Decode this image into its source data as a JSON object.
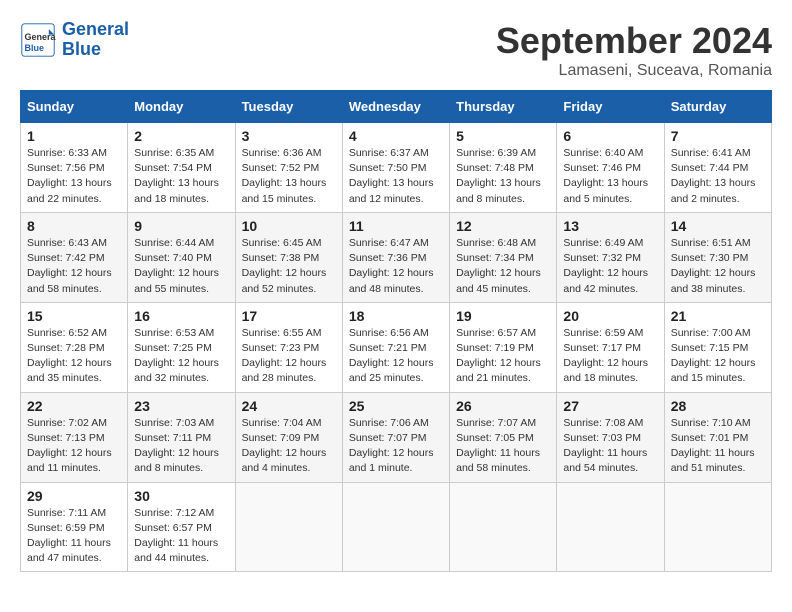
{
  "header": {
    "logo_text_general": "General",
    "logo_text_blue": "Blue",
    "month_year": "September 2024",
    "location": "Lamaseni, Suceava, Romania"
  },
  "weekdays": [
    "Sunday",
    "Monday",
    "Tuesday",
    "Wednesday",
    "Thursday",
    "Friday",
    "Saturday"
  ],
  "weeks": [
    [
      {
        "day": "1",
        "sunrise": "6:33 AM",
        "sunset": "7:56 PM",
        "daylight": "13 hours and 22 minutes."
      },
      {
        "day": "2",
        "sunrise": "6:35 AM",
        "sunset": "7:54 PM",
        "daylight": "13 hours and 18 minutes."
      },
      {
        "day": "3",
        "sunrise": "6:36 AM",
        "sunset": "7:52 PM",
        "daylight": "13 hours and 15 minutes."
      },
      {
        "day": "4",
        "sunrise": "6:37 AM",
        "sunset": "7:50 PM",
        "daylight": "13 hours and 12 minutes."
      },
      {
        "day": "5",
        "sunrise": "6:39 AM",
        "sunset": "7:48 PM",
        "daylight": "13 hours and 8 minutes."
      },
      {
        "day": "6",
        "sunrise": "6:40 AM",
        "sunset": "7:46 PM",
        "daylight": "13 hours and 5 minutes."
      },
      {
        "day": "7",
        "sunrise": "6:41 AM",
        "sunset": "7:44 PM",
        "daylight": "13 hours and 2 minutes."
      }
    ],
    [
      {
        "day": "8",
        "sunrise": "6:43 AM",
        "sunset": "7:42 PM",
        "daylight": "12 hours and 58 minutes."
      },
      {
        "day": "9",
        "sunrise": "6:44 AM",
        "sunset": "7:40 PM",
        "daylight": "12 hours and 55 minutes."
      },
      {
        "day": "10",
        "sunrise": "6:45 AM",
        "sunset": "7:38 PM",
        "daylight": "12 hours and 52 minutes."
      },
      {
        "day": "11",
        "sunrise": "6:47 AM",
        "sunset": "7:36 PM",
        "daylight": "12 hours and 48 minutes."
      },
      {
        "day": "12",
        "sunrise": "6:48 AM",
        "sunset": "7:34 PM",
        "daylight": "12 hours and 45 minutes."
      },
      {
        "day": "13",
        "sunrise": "6:49 AM",
        "sunset": "7:32 PM",
        "daylight": "12 hours and 42 minutes."
      },
      {
        "day": "14",
        "sunrise": "6:51 AM",
        "sunset": "7:30 PM",
        "daylight": "12 hours and 38 minutes."
      }
    ],
    [
      {
        "day": "15",
        "sunrise": "6:52 AM",
        "sunset": "7:28 PM",
        "daylight": "12 hours and 35 minutes."
      },
      {
        "day": "16",
        "sunrise": "6:53 AM",
        "sunset": "7:25 PM",
        "daylight": "12 hours and 32 minutes."
      },
      {
        "day": "17",
        "sunrise": "6:55 AM",
        "sunset": "7:23 PM",
        "daylight": "12 hours and 28 minutes."
      },
      {
        "day": "18",
        "sunrise": "6:56 AM",
        "sunset": "7:21 PM",
        "daylight": "12 hours and 25 minutes."
      },
      {
        "day": "19",
        "sunrise": "6:57 AM",
        "sunset": "7:19 PM",
        "daylight": "12 hours and 21 minutes."
      },
      {
        "day": "20",
        "sunrise": "6:59 AM",
        "sunset": "7:17 PM",
        "daylight": "12 hours and 18 minutes."
      },
      {
        "day": "21",
        "sunrise": "7:00 AM",
        "sunset": "7:15 PM",
        "daylight": "12 hours and 15 minutes."
      }
    ],
    [
      {
        "day": "22",
        "sunrise": "7:02 AM",
        "sunset": "7:13 PM",
        "daylight": "12 hours and 11 minutes."
      },
      {
        "day": "23",
        "sunrise": "7:03 AM",
        "sunset": "7:11 PM",
        "daylight": "12 hours and 8 minutes."
      },
      {
        "day": "24",
        "sunrise": "7:04 AM",
        "sunset": "7:09 PM",
        "daylight": "12 hours and 4 minutes."
      },
      {
        "day": "25",
        "sunrise": "7:06 AM",
        "sunset": "7:07 PM",
        "daylight": "12 hours and 1 minute."
      },
      {
        "day": "26",
        "sunrise": "7:07 AM",
        "sunset": "7:05 PM",
        "daylight": "11 hours and 58 minutes."
      },
      {
        "day": "27",
        "sunrise": "7:08 AM",
        "sunset": "7:03 PM",
        "daylight": "11 hours and 54 minutes."
      },
      {
        "day": "28",
        "sunrise": "7:10 AM",
        "sunset": "7:01 PM",
        "daylight": "11 hours and 51 minutes."
      }
    ],
    [
      {
        "day": "29",
        "sunrise": "7:11 AM",
        "sunset": "6:59 PM",
        "daylight": "11 hours and 47 minutes."
      },
      {
        "day": "30",
        "sunrise": "7:12 AM",
        "sunset": "6:57 PM",
        "daylight": "11 hours and 44 minutes."
      },
      null,
      null,
      null,
      null,
      null
    ]
  ]
}
